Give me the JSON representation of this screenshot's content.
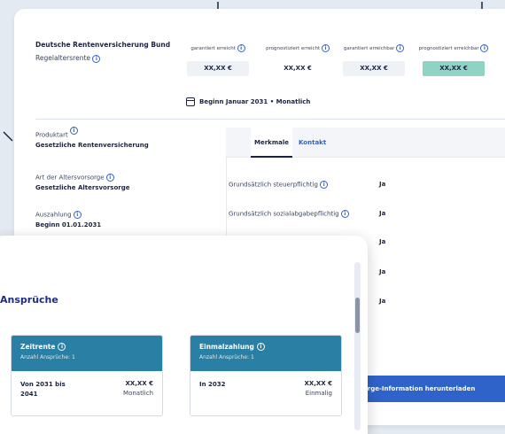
{
  "header": {
    "provider": "Deutsche Rentenversicherung Bund",
    "product_type": "Regelaltersrente"
  },
  "columns": [
    {
      "label": "garantiert erreicht",
      "value": "XX,XX €",
      "bg": "#eef1f6"
    },
    {
      "label": "prognostiziert erreicht",
      "value": "XX,XX €",
      "bg": "#ffffff"
    },
    {
      "label": "garantiert erreichbar",
      "value": "XX,XX €",
      "bg": "#eef1f6"
    },
    {
      "label": "prognostiziert erreichbar",
      "value": "XX,XX €",
      "bg": "#8fd3c5"
    }
  ],
  "date_line": "Beginn Januar 2031 • Monatlich",
  "product": [
    {
      "label": "Produktart",
      "value": "Gesetzliche Rentenversicherung"
    },
    {
      "label": "Art der Altersvorsorge",
      "value": "Gesetzliche Altersvorsorge"
    },
    {
      "label": "Auszahlung",
      "value": "Beginn 01.01.2031"
    }
  ],
  "tabs": [
    {
      "label": "Merkmale",
      "active": true
    },
    {
      "label": "Kontakt",
      "active": false
    }
  ],
  "merkmale": [
    {
      "label": "Grundsätzlich steuerpflichtig",
      "value": "Ja"
    },
    {
      "label": "Grundsätzlich sozialabgabepflichtig",
      "value": "Ja"
    },
    {
      "label": "",
      "value": "Ja"
    },
    {
      "label": "",
      "value": "Ja"
    },
    {
      "label": "",
      "value": "Ja"
    }
  ],
  "download_button": "orge-Information herunterladen",
  "ansprueche": {
    "title": "Ansprüche",
    "cards": [
      {
        "name": "Zeitrente",
        "count": "Anzahl Ansprüche: 1",
        "period": "Von 2031 bis 2041",
        "amount": "XX,XX €",
        "frequency": "Monatlich"
      },
      {
        "name": "Einmalzahlung",
        "count": "Anzahl Ansprüche: 1",
        "period": "In 2032",
        "amount": "XX,XX €",
        "frequency": "Einmalig"
      }
    ]
  },
  "colors": {
    "accent": "#2f63c9",
    "teal_header": "#2a7fa4",
    "highlight_value": "#8fd3c5",
    "title_blue": "#1a2f80"
  }
}
